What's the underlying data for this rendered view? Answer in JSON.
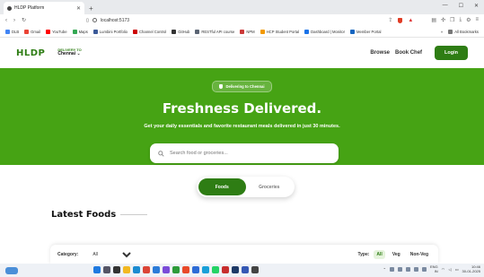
{
  "browser": {
    "tab_title": "HLDP Platform",
    "url": "localhost:5173",
    "bookmarks": [
      {
        "label": "DLB",
        "color": "#4285f4"
      },
      {
        "label": "Gmail",
        "color": "#ea4335"
      },
      {
        "label": "YouTube",
        "color": "#ff0000"
      },
      {
        "label": "Maps",
        "color": "#34a853"
      },
      {
        "label": "Lumbini Portfolio",
        "color": "#3b5998"
      },
      {
        "label": "Channel Control",
        "color": "#cc0000"
      },
      {
        "label": "GitHub",
        "color": "#333333"
      },
      {
        "label": "RESTful API course",
        "color": "#5a6473"
      },
      {
        "label": "NPM",
        "color": "#cb3837"
      },
      {
        "label": "HCP Student Portal",
        "color": "#f29900"
      },
      {
        "label": "Dashboard | Monitor",
        "color": "#1a73e8"
      },
      {
        "label": "Member Portal",
        "color": "#1565c0"
      }
    ],
    "all_bookmarks_label": "All Bookmarks"
  },
  "header": {
    "logo": "HLDP",
    "deliver_label": "DELIVERY TO",
    "city": "Chennai",
    "nav": [
      "Browse",
      "Book Chef"
    ],
    "login_label": "Login"
  },
  "hero": {
    "badge": "Delivering to Chennai",
    "title": "Freshness Delivered.",
    "subtitle": "Get your daily essentials and favorite restaurant meals delivered in just 30 minutes.",
    "search_placeholder": "Search food or groceries..."
  },
  "toggle": {
    "options": [
      {
        "label": "Foods",
        "active": true
      },
      {
        "label": "Groceries",
        "active": false
      }
    ]
  },
  "section": {
    "title": "Latest Foods"
  },
  "filters": {
    "category_label": "Category:",
    "category_value": "All",
    "type_label": "Type:",
    "types": [
      {
        "label": "All",
        "active": true
      },
      {
        "label": "Veg",
        "active": false
      },
      {
        "label": "Non-Veg",
        "active": false
      }
    ]
  },
  "taskbar": {
    "lang": "ENG",
    "region": "IN",
    "time": "10:46",
    "date": "30-01-2025"
  },
  "colors": {
    "brand": "#2e7d14",
    "hero": "#46a314"
  }
}
